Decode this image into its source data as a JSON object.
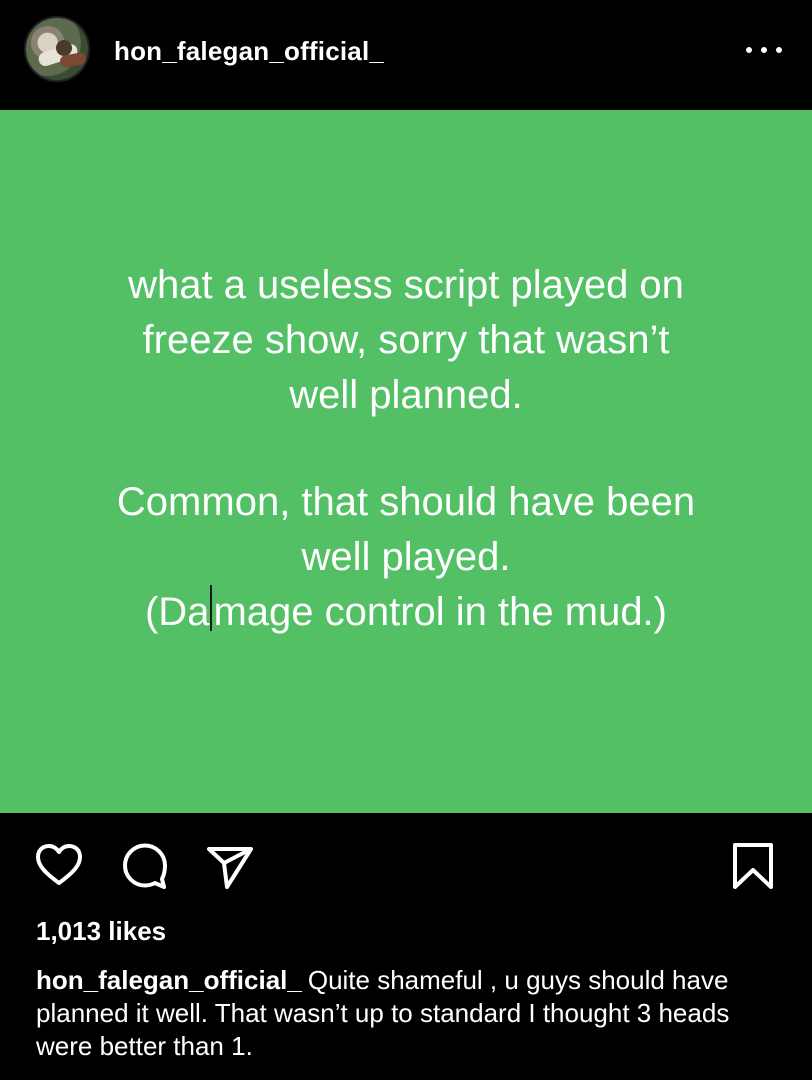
{
  "header": {
    "username": "hon_falegan_official_",
    "avatar_icon": "profile-avatar",
    "more_icon": "more-options-icon"
  },
  "post": {
    "background_color": "#53c066",
    "line1a": "what a useless script played on",
    "line1b": "freeze show, sorry that wasn’t",
    "line1c": "well planned.",
    "line2a": "Common, that should have been",
    "line2b": "well played.",
    "line3_before_caret": "(Da",
    "line3_after_caret": "mage control in the mud.)"
  },
  "actions": {
    "like_icon": "heart-icon",
    "comment_icon": "comment-icon",
    "share_icon": "send-icon",
    "save_icon": "bookmark-icon"
  },
  "likes": {
    "text": "1,013 likes"
  },
  "caption": {
    "username": "hon_falegan_official_",
    "text": "Quite shameful , u guys should have planned it well.  That wasn’t up to standard I thought 3 heads were better than 1."
  }
}
